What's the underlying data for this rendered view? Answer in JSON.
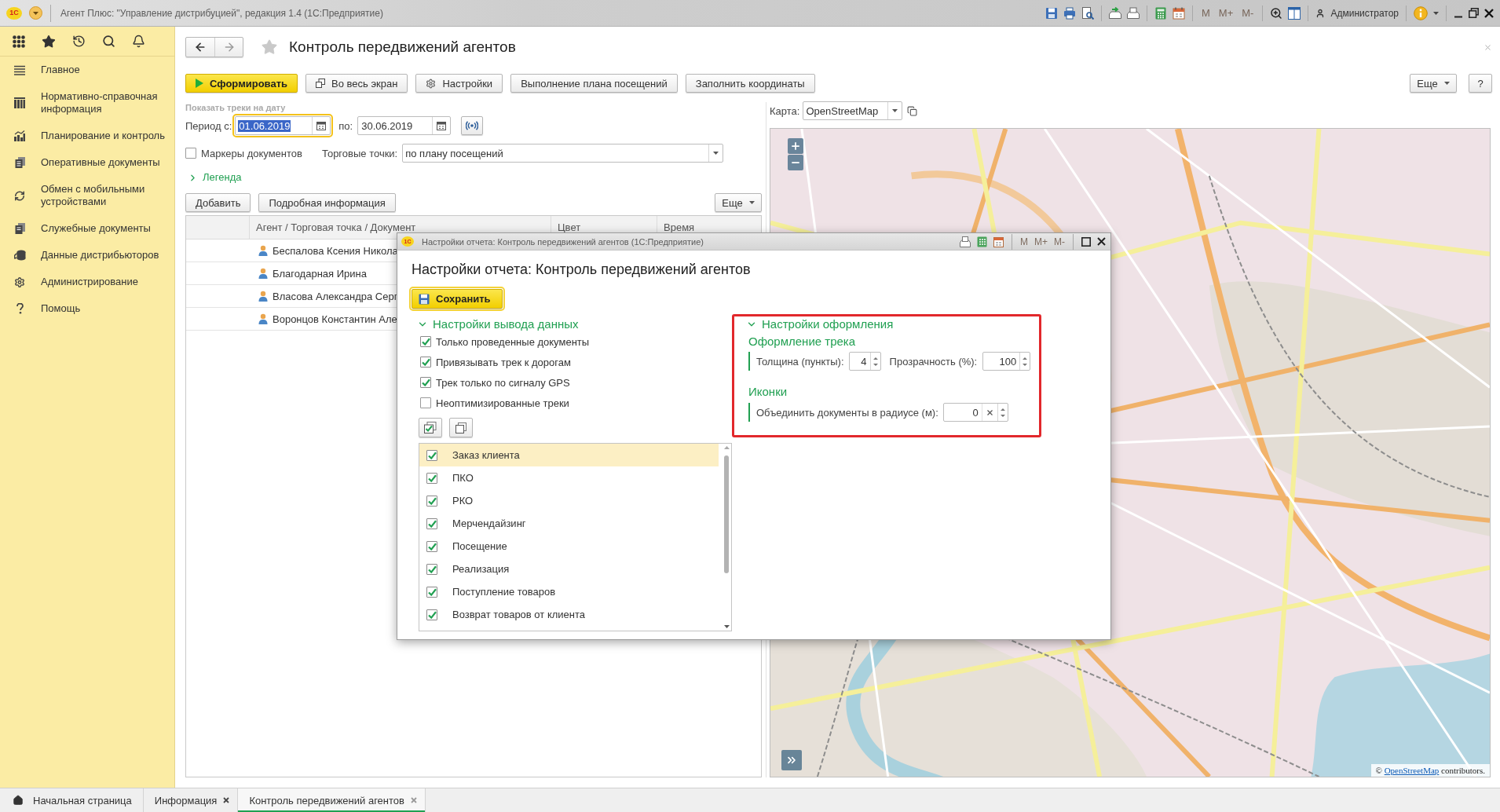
{
  "window": {
    "logo": "1С",
    "title": "Агент Плюс: \"Управление дистрибуцией\", редакция 1.4 (1С:Предприятие)",
    "memory_buttons": [
      {
        "label": "M",
        "disabled": true
      },
      {
        "label": "M+",
        "disabled": true
      },
      {
        "label": "M-",
        "disabled": true
      }
    ],
    "user": "Администратор"
  },
  "sidebar": {
    "items": [
      {
        "label": "Главное"
      },
      {
        "label": "Нормативно-справочная информация"
      },
      {
        "label": "Планирование и контроль"
      },
      {
        "label": "Оперативные документы"
      },
      {
        "label": "Обмен с мобильными устройствами"
      },
      {
        "label": "Служебные документы"
      },
      {
        "label": "Данные дистрибьюторов"
      },
      {
        "label": "Администрирование"
      },
      {
        "label": "Помощь"
      }
    ]
  },
  "page": {
    "title": "Контроль передвижений агентов",
    "toolbar": [
      {
        "label": "Сформировать",
        "kind": "primary"
      },
      {
        "label": "Во весь экран",
        "kind": "plain"
      },
      {
        "label": "Настройки",
        "kind": "plain"
      },
      {
        "label": "Выполнение плана посещений",
        "kind": "plain"
      },
      {
        "label": "Заполнить координаты",
        "kind": "plain"
      }
    ],
    "more_button": "Еще",
    "help_button": "?"
  },
  "filters": {
    "caption": "Показать треки на дату",
    "period_from_label": "Период с:",
    "period_from": {
      "value": "01.06.2019",
      "focused": true
    },
    "period_to_label": "по:",
    "period_to": {
      "value": "30.06.2019",
      "focused": false
    },
    "markers": {
      "label": "Маркеры документов",
      "checked": false
    },
    "outlets_label": "Торговые точки:",
    "outlets": "по плану посещений",
    "legend": {
      "label": "Легенда",
      "expanded": false
    }
  },
  "agents": {
    "buttons": [
      "Добавить",
      "Подробная информация"
    ],
    "more_button": "Еще",
    "columns": [
      "Агент / Торговая точка / Документ",
      "Цвет",
      "Время"
    ],
    "rows": [
      {
        "name": "Беспалова Ксения Никола"
      },
      {
        "name": "Благодарная Ирина"
      },
      {
        "name": "Власова Александра Серг"
      },
      {
        "name": "Воронцов Константин Але"
      }
    ]
  },
  "map": {
    "label": "Карта:",
    "provider": "OpenStreetMap",
    "attribution": {
      "prefix": "©",
      "link": "OpenStreetMap",
      "suffix": "contributors."
    }
  },
  "dialog": {
    "logo": "1С",
    "title": "Настройки отчета: Контроль передвижений агентов (1С:Предприятие)",
    "memory_buttons": [
      {
        "label": "M",
        "disabled": true
      },
      {
        "label": "M+",
        "disabled": true
      },
      {
        "label": "M-",
        "disabled": true
      }
    ],
    "heading": "Настройки отчета: Контроль передвижений агентов",
    "save_button": "Сохранить",
    "output_section": {
      "title": "Настройки вывода данных",
      "expanded": true,
      "options": [
        {
          "label": "Только проведенные документы",
          "checked": true
        },
        {
          "label": "Привязывать трек к дорогам",
          "checked": true
        },
        {
          "label": "Трек только по сигналу GPS",
          "checked": true
        },
        {
          "label": "Неоптимизированные треки",
          "checked": false
        }
      ],
      "document_types": [
        {
          "label": "Заказ клиента",
          "checked": true,
          "selected": true
        },
        {
          "label": "ПКО",
          "checked": true,
          "selected": false
        },
        {
          "label": "РКО",
          "checked": true,
          "selected": false
        },
        {
          "label": "Мерчендайзинг",
          "checked": true,
          "selected": false
        },
        {
          "label": "Посещение",
          "checked": true,
          "selected": false
        },
        {
          "label": "Реализация",
          "checked": true,
          "selected": false
        },
        {
          "label": "Поступление товаров",
          "checked": true,
          "selected": false
        },
        {
          "label": "Возврат товаров от клиента",
          "checked": true,
          "selected": false
        }
      ]
    },
    "appearance_section": {
      "title": "Настройки оформления",
      "expanded": true,
      "highlighted": true,
      "track_group": {
        "title": "Оформление трека",
        "thickness_label": "Толщина (пункты):",
        "thickness": "4",
        "opacity_label": "Прозрачность (%):",
        "opacity": "100"
      },
      "icons_group": {
        "title": "Иконки",
        "radius_label": "Объединить документы в радиусе (м):",
        "radius": "0"
      }
    }
  },
  "tabs": [
    {
      "label": "Начальная страница",
      "kind": "home",
      "selected": false,
      "closable": false
    },
    {
      "label": "Информация",
      "kind": "page",
      "selected": false,
      "closable": true
    },
    {
      "label": "Контроль передвижений агентов",
      "kind": "page",
      "selected": true,
      "closable": true
    }
  ]
}
